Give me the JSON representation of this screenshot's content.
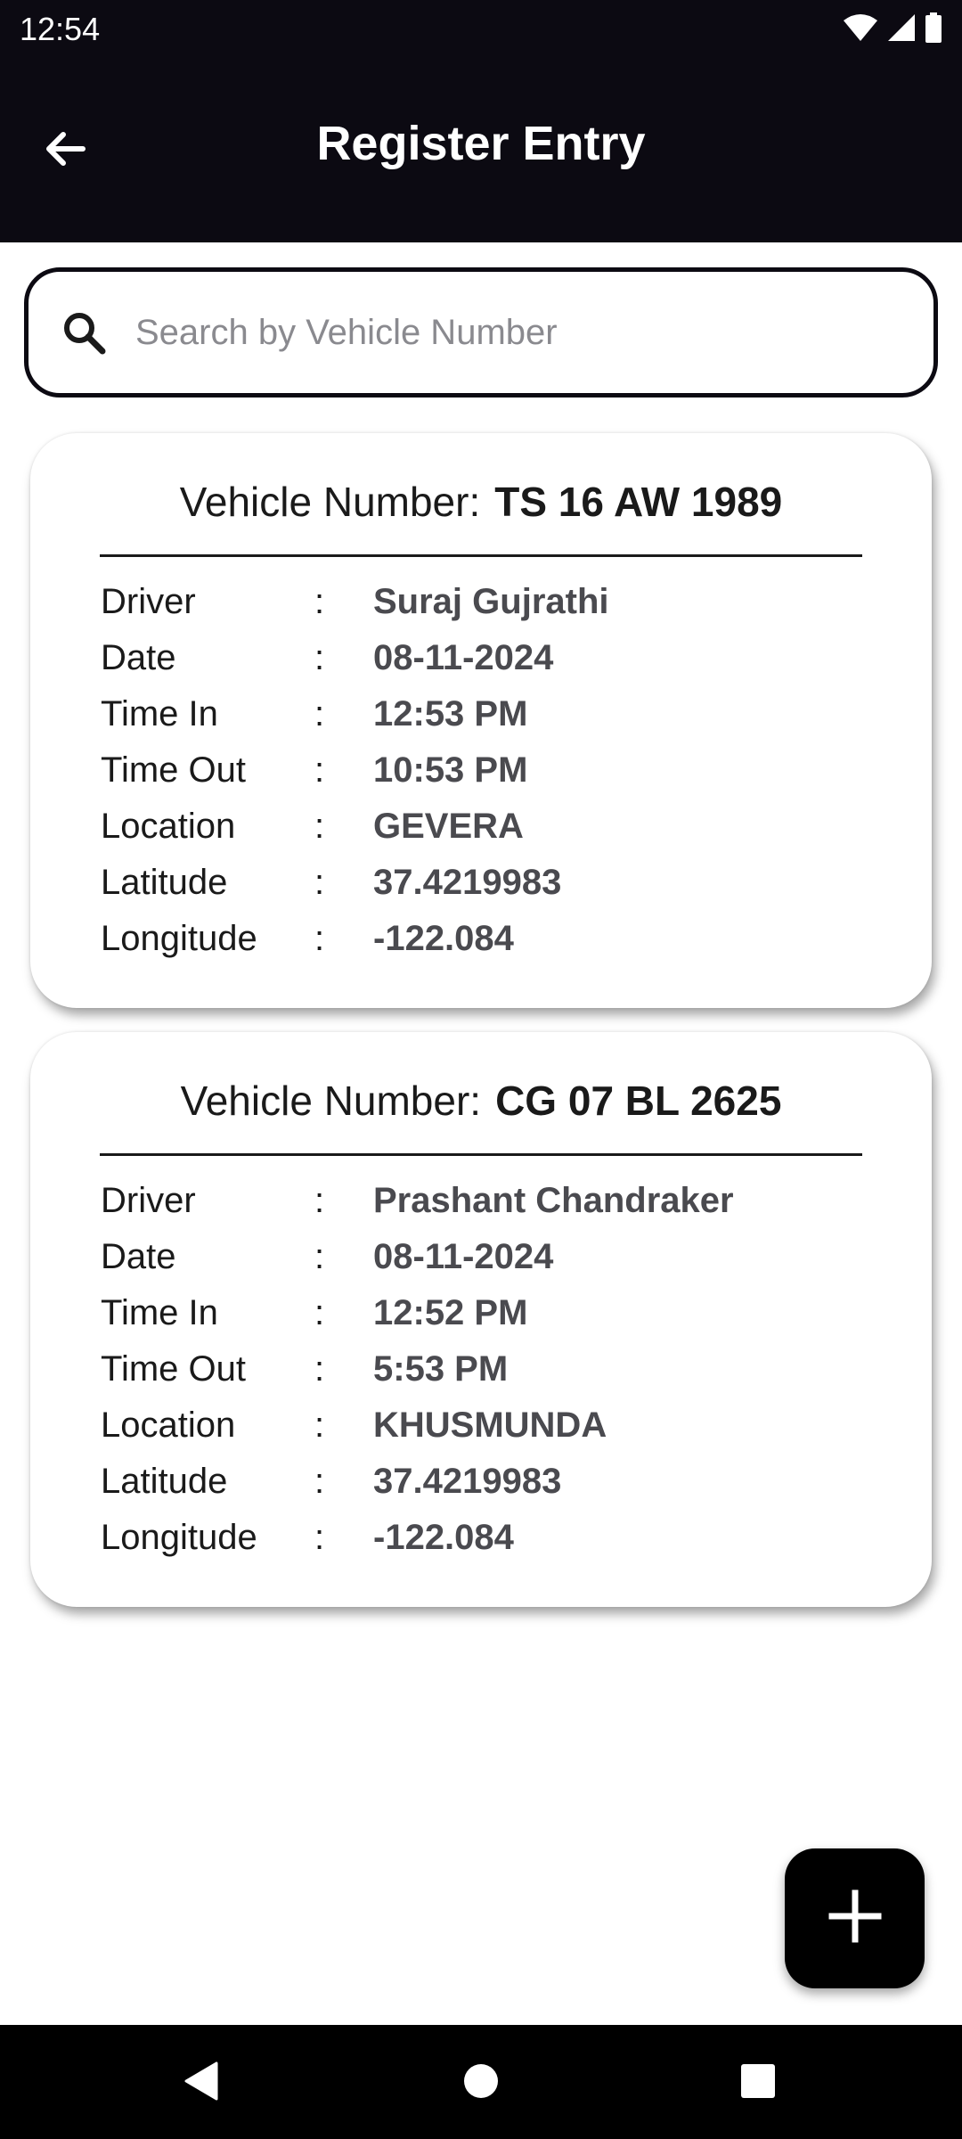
{
  "status_bar": {
    "time": "12:54"
  },
  "app_bar": {
    "title": "Register Entry"
  },
  "search": {
    "placeholder": "Search by Vehicle Number",
    "value": ""
  },
  "colors": {
    "app_bar_bg": "#0c0a12",
    "value_text": "#4a4a4f",
    "fab_bg": "#000000"
  },
  "icons": [
    "back-arrow-icon",
    "search-icon",
    "plus-icon",
    "wifi-icon",
    "signal-icon",
    "battery-icon"
  ],
  "entries": [
    {
      "vehicle_label": "Vehicle Number:",
      "vehicle_number": "TS 16 AW 1989",
      "fields": [
        {
          "key": "Driver",
          "sep": ":",
          "value": "Suraj Gujrathi"
        },
        {
          "key": "Date",
          "sep": ":",
          "value": "08-11-2024"
        },
        {
          "key": "Time In",
          "sep": ":",
          "value": "12:53 PM"
        },
        {
          "key": "Time Out",
          "sep": ":",
          "value": "10:53 PM"
        },
        {
          "key": "Location",
          "sep": ":",
          "value": "GEVERA"
        },
        {
          "key": "Latitude",
          "sep": ":",
          "value": "37.4219983"
        },
        {
          "key": "Longitude",
          "sep": ":",
          "value": "-122.084"
        }
      ]
    },
    {
      "vehicle_label": "Vehicle Number:",
      "vehicle_number": "CG 07 BL 2625",
      "fields": [
        {
          "key": "Driver",
          "sep": ":",
          "value": "Prashant Chandraker"
        },
        {
          "key": "Date",
          "sep": ":",
          "value": "08-11-2024"
        },
        {
          "key": "Time In",
          "sep": ":",
          "value": "12:52 PM"
        },
        {
          "key": "Time Out",
          "sep": ":",
          "value": "5:53 PM"
        },
        {
          "key": "Location",
          "sep": ":",
          "value": "KHUSMUNDA"
        },
        {
          "key": "Latitude",
          "sep": ":",
          "value": "37.4219983"
        },
        {
          "key": "Longitude",
          "sep": ":",
          "value": "-122.084"
        }
      ]
    }
  ]
}
